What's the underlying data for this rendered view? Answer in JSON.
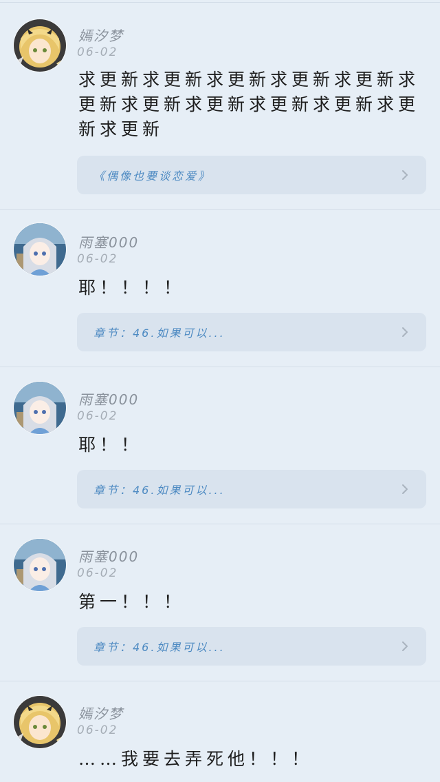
{
  "comments": [
    {
      "username": "嫣汐梦",
      "date": "06-02",
      "text": "求更新求更新求更新求更新求更新求更新求更新求更新求更新求更新求更新求更新",
      "link": "《偶像也要谈恋爱》",
      "avatar": "blonde-girl-avatar"
    },
    {
      "username": "雨塞000",
      "date": "06-02",
      "text": "耶！！！！",
      "link": "章节：46.如果可以...",
      "avatar": "silver-hair-girl-avatar"
    },
    {
      "username": "雨塞000",
      "date": "06-02",
      "text": "耶！！",
      "link": "章节：46.如果可以...",
      "avatar": "silver-hair-girl-avatar"
    },
    {
      "username": "雨塞000",
      "date": "06-02",
      "text": "第一！！！",
      "link": "章节：46.如果可以...",
      "avatar": "silver-hair-girl-avatar"
    },
    {
      "username": "嫣汐梦",
      "date": "06-02",
      "text": "……我要去弄死他！！！",
      "avatar": "blonde-girl-avatar"
    }
  ],
  "icons": {
    "chevron": "chevron-right-icon"
  },
  "colors": {
    "background": "#e6eef6",
    "card": "#d9e3ee",
    "link": "#4d8ac2",
    "meta": "#8a929c"
  }
}
